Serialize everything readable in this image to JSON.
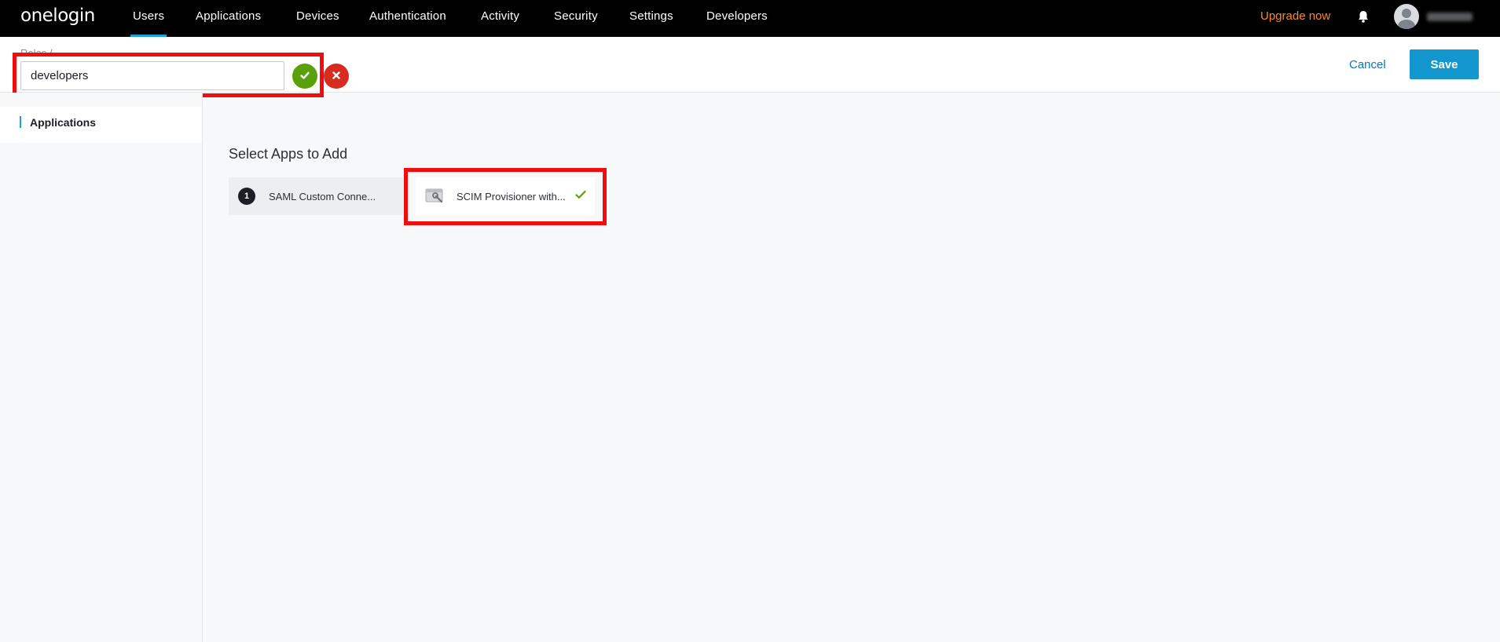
{
  "brand": {
    "logo_text": "onelogin"
  },
  "nav": {
    "items": [
      {
        "label": "Users",
        "active": true
      },
      {
        "label": "Applications",
        "active": false
      },
      {
        "label": "Devices",
        "active": false
      },
      {
        "label": "Authentication",
        "active": false
      },
      {
        "label": "Activity",
        "active": false
      },
      {
        "label": "Security",
        "active": false
      },
      {
        "label": "Settings",
        "active": false
      },
      {
        "label": "Developers",
        "active": false
      }
    ],
    "upgrade_label": "Upgrade now",
    "notification_icon": "bell-icon",
    "avatar_icon": "user-avatar-icon"
  },
  "header": {
    "breadcrumb": "Roles /",
    "role_name_value": "developers",
    "confirm_icon": "check-icon",
    "reject_icon": "close-icon",
    "cancel_label": "Cancel",
    "save_label": "Save"
  },
  "sidebar": {
    "items": [
      {
        "label": "Applications",
        "active": true
      }
    ]
  },
  "main": {
    "section_title": "Select Apps to Add",
    "apps": [
      {
        "badge": "1",
        "label": "SAML Custom Conne..."
      },
      {
        "label": "SCIM Provisioner with...",
        "icon": "app-wrench-icon",
        "selected": true
      }
    ]
  },
  "colors": {
    "accent": "#1e9fd6",
    "save_button": "#1496cf",
    "confirm": "#5aa00a",
    "reject": "#d72b1f",
    "upgrade": "#f7892a",
    "annotation": "#ef0d0d"
  }
}
